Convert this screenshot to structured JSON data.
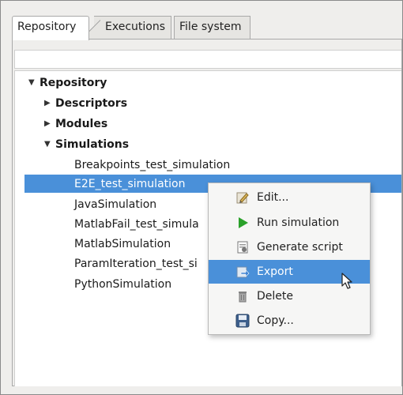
{
  "tabs": [
    {
      "label": "Repository",
      "active": true
    },
    {
      "label": "Executions",
      "active": false
    },
    {
      "label": "File system",
      "active": false
    }
  ],
  "tree": {
    "root": "Repository",
    "nodes": [
      {
        "label": "Descriptors",
        "expanded": false
      },
      {
        "label": "Modules",
        "expanded": false
      },
      {
        "label": "Simulations",
        "expanded": true
      }
    ],
    "simulations": [
      "Breakpoints_test_simulation",
      "E2E_test_simulation",
      "JavaSimulation",
      "MatlabFail_test_simula",
      "MatlabSimulation",
      "ParamIteration_test_si",
      "PythonSimulation"
    ],
    "selected_index": 1
  },
  "context_menu": {
    "items": [
      {
        "label": "Edit...",
        "icon": "edit-icon"
      },
      {
        "label": "Run simulation",
        "icon": "run-icon"
      },
      {
        "label": "Generate script",
        "icon": "script-icon"
      },
      {
        "label": "Export",
        "icon": "export-icon",
        "highlighted": true
      },
      {
        "label": "Delete",
        "icon": "delete-icon"
      },
      {
        "label": "Copy...",
        "icon": "copy-icon"
      }
    ]
  },
  "colors": {
    "selection": "#4a90d9",
    "run_green": "#2aa12a"
  }
}
